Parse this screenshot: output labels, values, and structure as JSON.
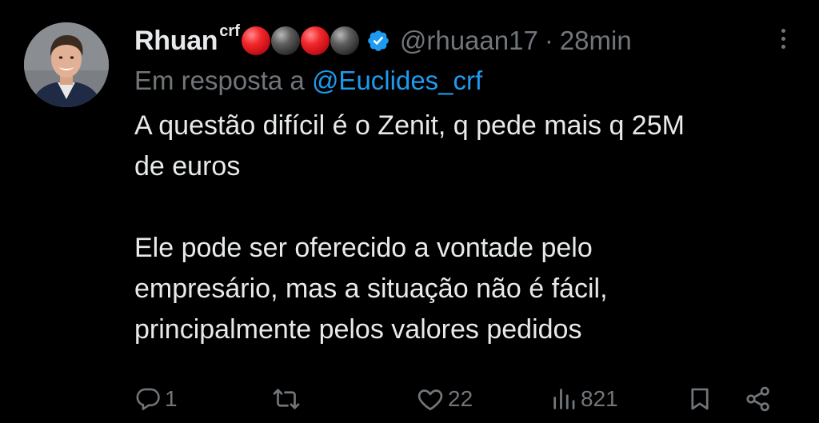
{
  "tweet": {
    "display_name": "Rhuan",
    "name_superscript": "crf",
    "name_emojis": [
      "red-ball",
      "black-ball",
      "red-ball",
      "black-ball"
    ],
    "verified": true,
    "handle": "@rhuaan17",
    "separator": "·",
    "time": "28min",
    "reply_prefix": "Em resposta a",
    "reply_to": "@Euclides_crf",
    "text": "A questão difícil é o Zenit, q pede mais q 25M\nde euros\n\nEle pode ser oferecido a vontade pelo\nempresário, mas a situação não é fácil,\nprincipalmente pelos valores pedidos"
  },
  "actions": {
    "replies": "1",
    "retweets": "",
    "likes": "22",
    "views": "821"
  },
  "colors": {
    "background": "#000000",
    "text_primary": "#e7e9ea",
    "text_secondary": "#71767b",
    "accent": "#1d9bf0",
    "emoji_red": "#e0232a",
    "emoji_black": "#333333"
  },
  "icons": {
    "reply": "speech-bubble-icon",
    "retweet": "retweet-icon",
    "like": "heart-icon",
    "views": "bar-chart-icon",
    "bookmark": "bookmark-icon",
    "share": "share-icon",
    "more": "more-vertical-icon",
    "verified": "verified-badge-icon"
  }
}
